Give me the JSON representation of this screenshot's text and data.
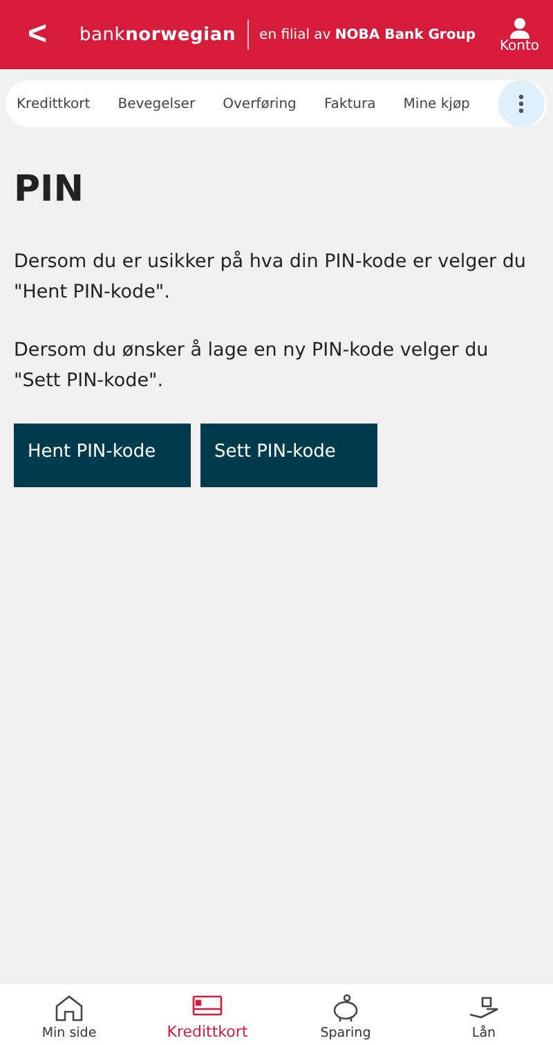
{
  "header": {
    "back": "<",
    "logo": "bank**norwegian**",
    "tagline": "en filial av **NOBA Bank Group**",
    "account": "Konto"
  },
  "subnav": {
    "items": [
      {
        "label": "Kredittkort"
      },
      {
        "label": "Bevegelser"
      },
      {
        "label": "Overføring"
      },
      {
        "label": "Faktura"
      },
      {
        "label": "Mine kjøp"
      }
    ]
  },
  "page": {
    "title": "PIN",
    "paragraphs": [
      "Dersom du er usikker på hva din PIN-kode er velger du \"Hent PIN-kode\".",
      "Dersom du ønsker å lage en ny PIN-kode velger du \"Sett PIN-kode\"."
    ],
    "buttons": [
      "Hent PIN-kode",
      "Sett PIN-kode"
    ]
  },
  "bottom_nav": [
    {
      "kind": "home",
      "label": "Min side",
      "selected": false
    },
    {
      "kind": "card",
      "label": "Kredittkort",
      "selected": true
    },
    {
      "kind": "piggy",
      "label": "Sparing",
      "selected": false
    },
    {
      "kind": "loan",
      "label": "Lån",
      "selected": false
    }
  ]
}
